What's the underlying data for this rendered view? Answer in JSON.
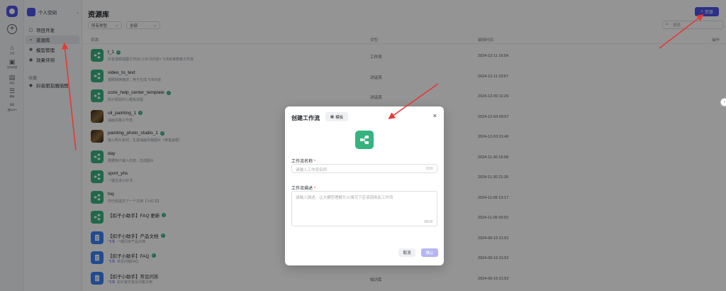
{
  "rail": [
    {
      "icon": "home-icon",
      "glyph": "⌂",
      "label": "主页"
    },
    {
      "icon": "workspace-icon",
      "glyph": "▣",
      "label": "空间资源"
    },
    {
      "icon": "store-icon",
      "glyph": "▤",
      "label": "商店"
    },
    {
      "icon": "templates-icon",
      "glyph": "☰",
      "label": "模板"
    },
    {
      "icon": "link-icon",
      "glyph": "∞",
      "label": "插件API"
    }
  ],
  "workspace": {
    "name": "个人空间"
  },
  "nav": {
    "items": [
      {
        "label": "项目开发",
        "icon": "▢"
      },
      {
        "label": "资源库",
        "icon": "▪"
      },
      {
        "label": "模型管理",
        "icon": "✺"
      },
      {
        "label": "效果评测",
        "icon": "◉"
      }
    ],
    "section": "收藏",
    "favorites": [
      {
        "label": "抖音朋友圈插图",
        "icon": "◆"
      }
    ]
  },
  "main": {
    "title": "资源库",
    "create_label": "资源",
    "filter_type": "所有类型",
    "filter_scope": "全部",
    "search_placeholder": "搜索",
    "columns": {
      "resource": "资源",
      "type": "类型",
      "time": "编辑时间",
      "action": "操作"
    },
    "rows": [
      {
        "name": "t_1",
        "ok": true,
        "thumb": "green",
        "desc": "抖音视频插图工作流+小红书内容+飞书多维表格工作流",
        "type": "工作流",
        "time": "2024-12-11 16:54"
      },
      {
        "name": "video_to_text",
        "ok": false,
        "thumb": "green",
        "desc": "视频转换描述，用于生成飞书内容",
        "type": "对话流",
        "time": "2024-12-11 23:57"
      },
      {
        "name": "coze_help_center_template",
        "ok": true,
        "thumb": "green",
        "desc": "扣子帮助中心模板流程",
        "type": "对话流",
        "time": "2024-12-09 11:29"
      },
      {
        "name": "oil_painting_1",
        "ok": true,
        "thumb": "photo",
        "desc": "油画风格工作流",
        "type": "",
        "time": "2024-12-04 09:57"
      },
      {
        "name": "painting_photo_studio_1",
        "ok": true,
        "thumb": "photo",
        "desc": "输入照片素材，生成油画风格图片（黄金画框）",
        "type": "",
        "time": "2024-12-03 01:40"
      },
      {
        "name": "day",
        "ok": false,
        "thumb": "green",
        "desc": "根据用户输入内容，生成图片",
        "type": "",
        "time": "2024-11-30 16:08"
      },
      {
        "name": "sport_yhs",
        "ok": false,
        "thumb": "green",
        "desc": "一键生成小红书",
        "type": "",
        "time": "2024-11-30 21:39"
      },
      {
        "name": "hej",
        "ok": false,
        "thumb": "green",
        "desc": "你已经提交了一个文档【小红书】",
        "type": "",
        "time": "2024-11-09 13:17"
      },
      {
        "name": "【扣子小助手】FAQ 更新",
        "ok": true,
        "thumb": "green",
        "tag": "",
        "desc": "",
        "type": "",
        "time": "2024-11-05 00:02"
      },
      {
        "name": "【扣子小助手】产品文档",
        "ok": true,
        "thumb": "blue",
        "tag": "飞书",
        "desc": "一键同步产品文档",
        "type": "",
        "time": "2024-09-19 21:52"
      },
      {
        "name": "【扣子小助手】FAQ",
        "ok": true,
        "thumb": "blue",
        "tag": "飞书",
        "desc": "常见问题FAQ",
        "type": "",
        "time": "2024-09-19 21:52"
      },
      {
        "name": "【扣子小助手】常见问答",
        "ok": false,
        "thumb": "blue",
        "tag": "飞书",
        "desc": "扣子官方常见问答文档",
        "type": "知识库",
        "time": "2024-09-19 21:52"
      }
    ]
  },
  "modal": {
    "title": "创建工作流",
    "template_label": "模板",
    "name_label": "工作流名称",
    "name_placeholder": "请输入工作流名称",
    "name_count": "0/30",
    "desc_label": "工作流描述",
    "desc_placeholder": "请输入描述，让大模型理解什么情况下应该调用此工作流",
    "desc_count": "0/600",
    "cancel_label": "取消",
    "confirm_label": "确认"
  },
  "colors": {
    "brand": "#4d53e8",
    "workflow_green": "#36b37e",
    "arrow_red": "#e53935"
  }
}
